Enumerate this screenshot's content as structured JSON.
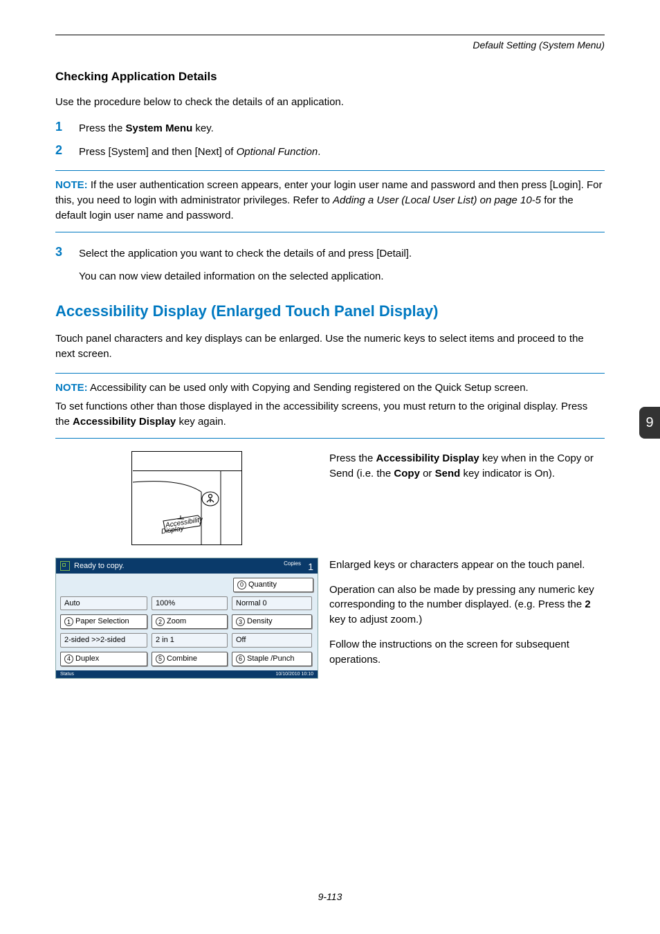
{
  "running_head": "Default Setting (System Menu)",
  "side_tab": "9",
  "check_section": {
    "title": "Checking Application Details",
    "intro": "Use the procedure below to check the details of an application.",
    "steps12": {
      "s1_num": "1",
      "s1_a": "Press the ",
      "s1_b": "System Menu",
      "s1_c": " key.",
      "s2_num": "2",
      "s2_a": "Press [System] and then [Next] of ",
      "s2_b": "Optional Function",
      "s2_c": "."
    },
    "note1": {
      "label": "NOTE:",
      "a": " If the user authentication screen appears, enter your login user name and password and then press [Login]. For this, you need to login with administrator privileges. Refer to ",
      "b": "Adding a User (Local User List) on page 10-5",
      "c": " for the default login user name and password."
    },
    "step3": {
      "num": "3",
      "a": "Select the application you want to check the details of and press [Detail].",
      "b": "You can now view detailed information on the selected application."
    }
  },
  "access_section": {
    "title": "Accessibility Display (Enlarged Touch Panel Display)",
    "intro": "Touch panel characters and key displays can be enlarged. Use the numeric keys to select items and proceed to the next screen.",
    "note2": {
      "label": "NOTE:",
      "a": " Accessibility can be used only with Copying and Sending registered on the Quick Setup screen.",
      "b": "To set functions other than those displayed in the accessibility screens, you must return to the original display. Press the ",
      "c": "Accessibility Display",
      "d": " key again."
    },
    "illus_label_1": "Accessibility",
    "illus_label_2": "Display",
    "right1_a": "Press the ",
    "right1_b": "Accessibility Display",
    "right1_c": " key when in the Copy or Send (i.e. the ",
    "right1_d": "Copy",
    "right1_e": " or ",
    "right1_f": "Send",
    "right1_g": " key indicator is On).",
    "right2": "Enlarged keys or characters appear on the touch panel.",
    "right3_a": "Operation can also be made by pressing any numeric key corresponding to the number displayed. (e.g. Press the ",
    "right3_b": "2",
    "right3_c": " key to adjust zoom.)",
    "right4": "Follow the instructions on the screen for subsequent operations."
  },
  "panel": {
    "header": "Ready to copy.",
    "copies_label": "Copies",
    "copies_count": "1",
    "quantity_n": "0",
    "quantity": "Quantity",
    "r1c1": "Auto",
    "r1c2": "100%",
    "r1c3": "Normal 0",
    "r2c1_n": "1",
    "r2c1": "Paper Selection",
    "r2c2_n": "2",
    "r2c2": "Zoom",
    "r2c3_n": "3",
    "r2c3": "Density",
    "r3c1": "2-sided >>2-sided",
    "r3c2": "2 in 1",
    "r3c3": "Off",
    "r4c1_n": "4",
    "r4c1": "Duplex",
    "r4c2_n": "5",
    "r4c2": "Combine",
    "r4c3_n": "6",
    "r4c3": "Staple /Punch",
    "status_left": "Status",
    "status_right": "10/10/2010  10:10"
  },
  "footer": "9-113"
}
